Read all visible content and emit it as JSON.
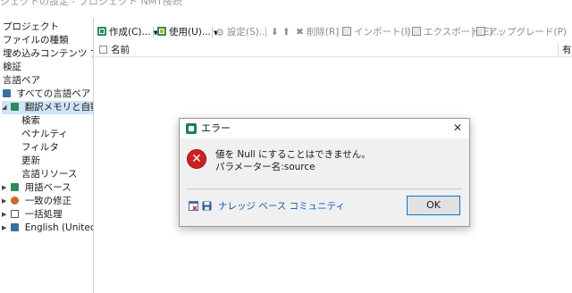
{
  "window": {
    "title": "ジェクトの設定 - プロジェクト NMT接続"
  },
  "sidebar": {
    "items": [
      {
        "label": "プロジェクト"
      },
      {
        "label": "ファイルの種類"
      },
      {
        "label": "埋め込みコンテンツ プロセ"
      },
      {
        "label": "検証"
      },
      {
        "label": "言語ペア"
      },
      {
        "label": "すべての言語ペア",
        "icon": "language-pairs-icon",
        "icon_color": "#3a6ea5"
      },
      {
        "label": "翻訳メモリと自動翻",
        "icon": "translation-memory-icon",
        "icon_color": "#2e8b57",
        "selected": true
      },
      {
        "label": "検索"
      },
      {
        "label": "ペナルティ"
      },
      {
        "label": "フィルタ"
      },
      {
        "label": "更新"
      },
      {
        "label": "言語リソース"
      },
      {
        "label": "用語ベース",
        "icon": "termbase-icon",
        "icon_color": "#2e8b57"
      },
      {
        "label": "一致の修正",
        "icon": "match-repair-icon",
        "icon_color": "#d2691e"
      },
      {
        "label": "一括処理",
        "icon": "batch-processing-icon",
        "icon_color": "#555555"
      },
      {
        "label": "English (United State",
        "icon": "language-icon",
        "icon_color": "#3a6ea5"
      }
    ]
  },
  "toolbar": {
    "create": "作成(C)...",
    "use": "使用(U)...",
    "settings": "設定(S)...",
    "delete": "削除(R)",
    "import": "インポート(I)...",
    "export": "エクスポート(E)...",
    "upgrade": "アップグレード(P)"
  },
  "table": {
    "columns": [
      "名前",
      "有"
    ]
  },
  "dialog": {
    "title": "エラー",
    "message_line1": "値を Null にすることはできません。",
    "message_line2": "パラメーター名:source",
    "kb_link": "ナレッジ ベース コミュニティ",
    "ok_label": "OK"
  },
  "colors": {
    "accent": "#0078d7",
    "selection": "#cfe4f7",
    "error": "#d01f1f",
    "link": "#0a5fb4"
  }
}
